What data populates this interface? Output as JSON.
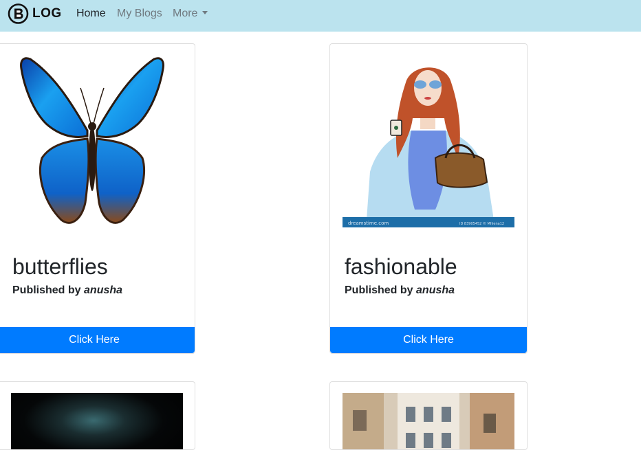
{
  "brand": {
    "logo_letter": "B",
    "text": "LOG"
  },
  "nav": {
    "home": "Home",
    "my_blogs": "My Blogs",
    "more": "More"
  },
  "cards": [
    {
      "title": "butterflies",
      "published_prefix": "Published by",
      "author": "anusha",
      "button": "Click Here"
    },
    {
      "title": "fashionable",
      "published_prefix": "Published by",
      "author": "anusha",
      "button": "Click Here"
    }
  ],
  "colors": {
    "navbar_bg": "#bbe3ee",
    "button_bg": "#007bff"
  },
  "icons": {
    "brand": "blogger-b-icon",
    "dropdown": "caret-down-icon"
  }
}
